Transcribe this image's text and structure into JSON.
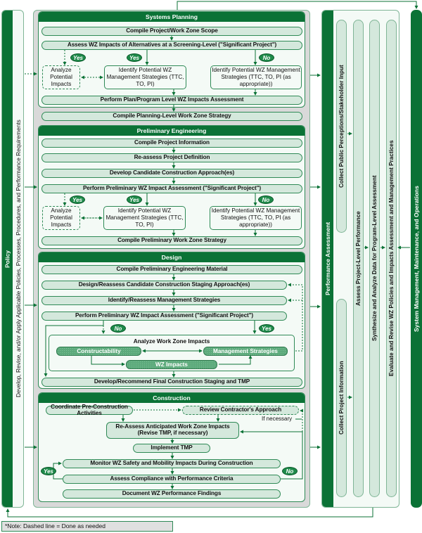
{
  "policy": {
    "title": "Policy",
    "description": "Develop, Revise, and/or Apply Applicable Policies, Processes, Procedures, and Performance Requirements"
  },
  "phases": {
    "systems_planning": {
      "title": "Systems Planning",
      "step1": "Compile Project/Work Zone Scope",
      "step2": "Assess WZ Impacts of Alternatives at a Screening-Level (\"Significant Project\")",
      "analyze": "Analyze Potential Impacts",
      "identify_yes": "Identify Potential WZ Management Strategies (TTC, TO, PI)",
      "identify_no": "Identify Potential WZ Management Strategies (TTC, TO, PI (as appropriate))",
      "step3": "Perform Plan/Program Level WZ Impacts Assessment",
      "step4": "Compile Planning-Level Work Zone Strategy",
      "badge_yes": "Yes",
      "badge_no": "No"
    },
    "preliminary_engineering": {
      "title": "Preliminary Engineering",
      "step1": "Compile Project Information",
      "step2": "Re-assess Project Definition",
      "step3": "Develop Candidate Construction Approach(es)",
      "step4": "Perform Preliminary WZ Impact Assessment (\"Significant Project\")",
      "analyze": "Analyze Potential Impacts",
      "identify_yes": "Identify Potential WZ Management Strategies (TTC, TO, PI)",
      "identify_no": "Identify Potential WZ Management Strategies (TTC, TO, PI (as appropriate))",
      "step5": "Compile Preliminary Work Zone Strategy",
      "badge_yes": "Yes",
      "badge_no": "No"
    },
    "design": {
      "title": "Design",
      "step1": "Compile Preliminary Engineering Material",
      "step2": "Design/Reassess Candidate Construction Staging Approach(es)",
      "step3": "Identify/Reassess Management Strategies",
      "step4": "Perform Preliminary WZ Impact Assessment (\"Significant Project\")",
      "analyze_title": "Analyze Work Zone Impacts",
      "constructability": "Constructability",
      "management_strategies": "Management Strategies",
      "wz_impacts": "WZ Impacts",
      "step5": "Develop/Recommend Final Construction Staging and TMP",
      "badge_yes": "Yes",
      "badge_no": "No"
    },
    "construction": {
      "title": "Construction",
      "coordinate": "Coordinate Pre-Construction Activities",
      "review": "Review Contractor's Approach",
      "if_necessary": "If necessary",
      "reassess": "Re-Assess Anticipated Work Zone Impacts (Revise TMP, if necessary)",
      "implement": "Implement TMP",
      "monitor": "Monitor WZ Safety and Mobility Impacts During Construction",
      "assess": "Assess Compliance with Performance Criteria",
      "document": "Document WZ Performance Findings",
      "badge_yes": "Yes",
      "badge_no": "No"
    }
  },
  "performance_assessment": {
    "title": "Performance Assessment",
    "collect_public": "Collect Public Perceptions/Stakeholder Input",
    "collect_project": "Collect Project Information",
    "assess_project": "Assess Project-Level Performance",
    "synthesize": "Synthesize and Analyze Data for Program-Level Assessment",
    "evaluate": "Evaluate and Revise WZ Policies and Impacts Assessment and Management Practices"
  },
  "system_management": {
    "title": "System Management, Maintenance, and Operations"
  },
  "note": "*Note: Dashed line = Done as needed",
  "colors": {
    "dark_green": "#0b7236",
    "light_green": "#d4e8dc",
    "border_green": "#2f8a56",
    "panel_gray": "#d9d9d9"
  }
}
